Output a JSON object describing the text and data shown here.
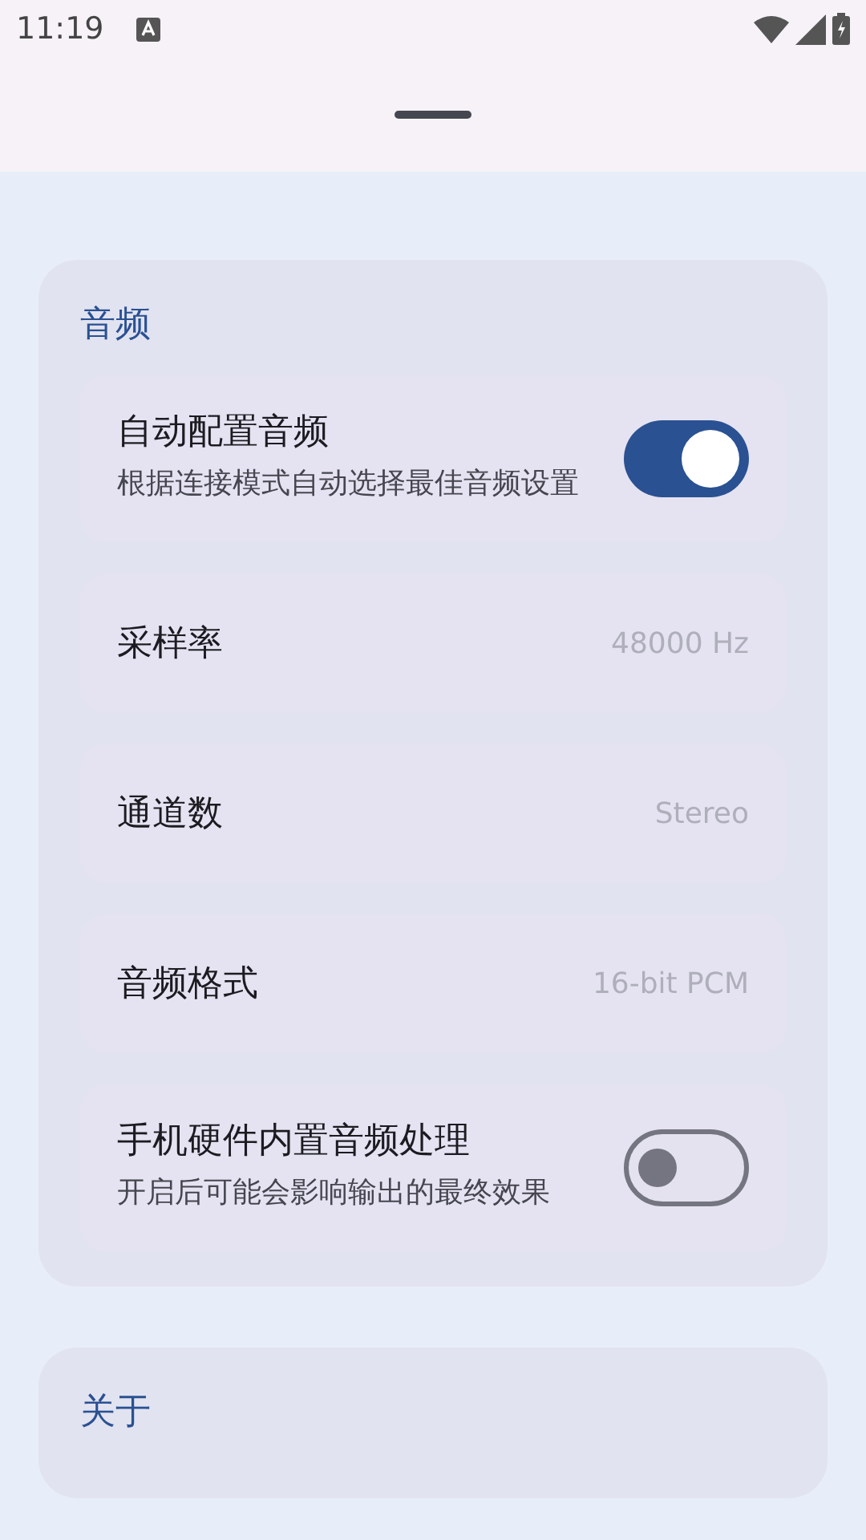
{
  "status_bar": {
    "time": "11:19"
  },
  "sections": [
    {
      "title": "音频",
      "items": [
        {
          "kind": "switch",
          "label": "自动配置音频",
          "description": "根据连接模式自动选择最佳音频设置",
          "on": true
        },
        {
          "kind": "value",
          "label": "采样率",
          "value": "48000 Hz"
        },
        {
          "kind": "value",
          "label": "通道数",
          "value": "Stereo"
        },
        {
          "kind": "value",
          "label": "音频格式",
          "value": "16-bit PCM"
        },
        {
          "kind": "switch",
          "label": "手机硬件内置音频处理",
          "description": "开启后可能会影响输出的最终效果",
          "on": false
        }
      ]
    },
    {
      "title": "关于"
    }
  ]
}
